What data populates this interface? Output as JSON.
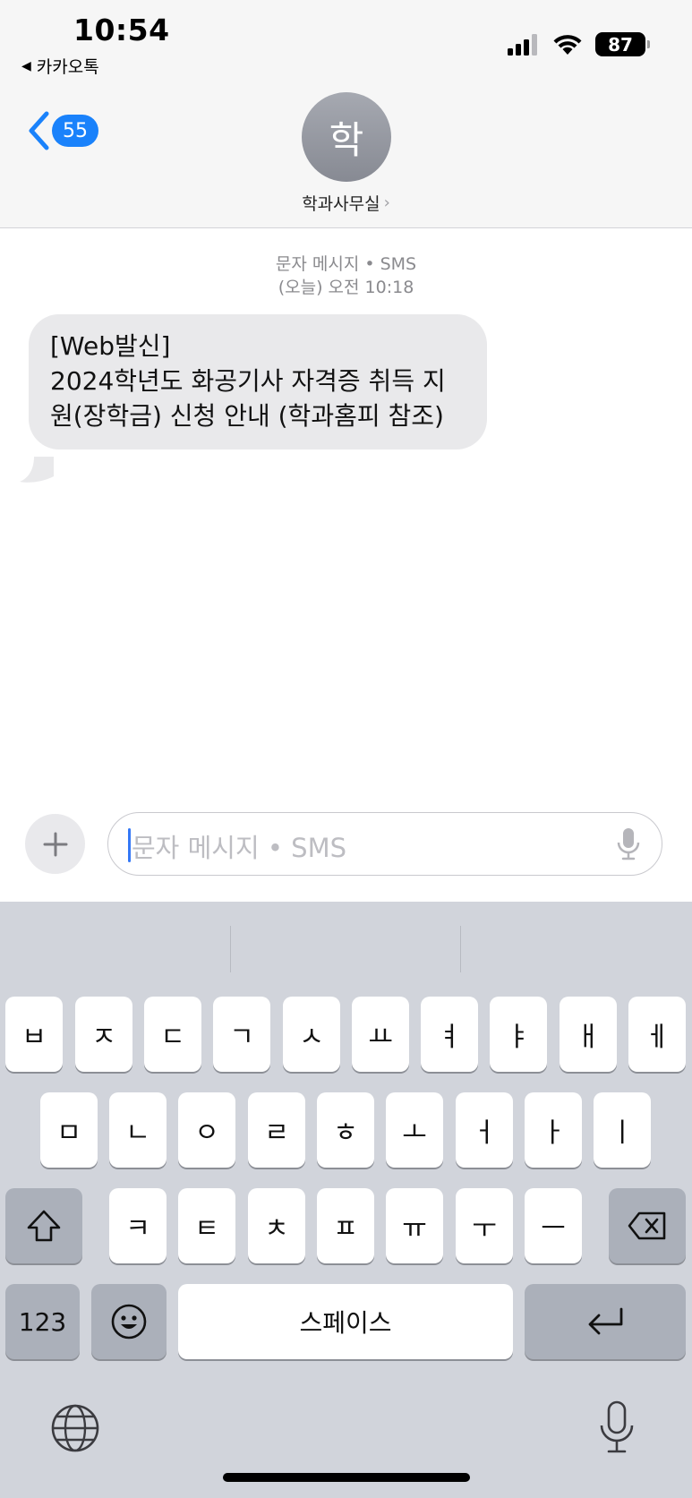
{
  "status_bar": {
    "time": "10:54",
    "back_app": "카카오톡",
    "battery": "87",
    "icons": [
      "cellular-signal-icon",
      "wifi-icon",
      "battery-icon"
    ]
  },
  "nav": {
    "back_badge": "55",
    "avatar_initial": "학",
    "contact_name": "학과사무실"
  },
  "conversation": {
    "meta_type": "문자 메시지 • SMS",
    "meta_time": "(오늘) 오전 10:18",
    "messages": [
      {
        "line1": "[Web발신]",
        "line2": "2024학년도 화공기사 자격증 취득 지원(장학금) 신청 안내 (학과홈피 참조)"
      }
    ]
  },
  "compose": {
    "placeholder": "문자 메시지 • SMS"
  },
  "keyboard": {
    "row1": [
      "ㅂ",
      "ㅈ",
      "ㄷ",
      "ㄱ",
      "ㅅ",
      "ㅛ",
      "ㅕ",
      "ㅑ",
      "ㅐ",
      "ㅔ"
    ],
    "row2": [
      "ㅁ",
      "ㄴ",
      "ㅇ",
      "ㄹ",
      "ㅎ",
      "ㅗ",
      "ㅓ",
      "ㅏ",
      "ㅣ"
    ],
    "row3": [
      "ㅋ",
      "ㅌ",
      "ㅊ",
      "ㅍ",
      "ㅠ",
      "ㅜ",
      "ㅡ"
    ],
    "numbers_label": "123",
    "space_label": "스페이스"
  },
  "colors": {
    "accent": "#1a82fb",
    "bubble": "#e9e9eb",
    "keyboard_bg": "#d1d4db"
  }
}
